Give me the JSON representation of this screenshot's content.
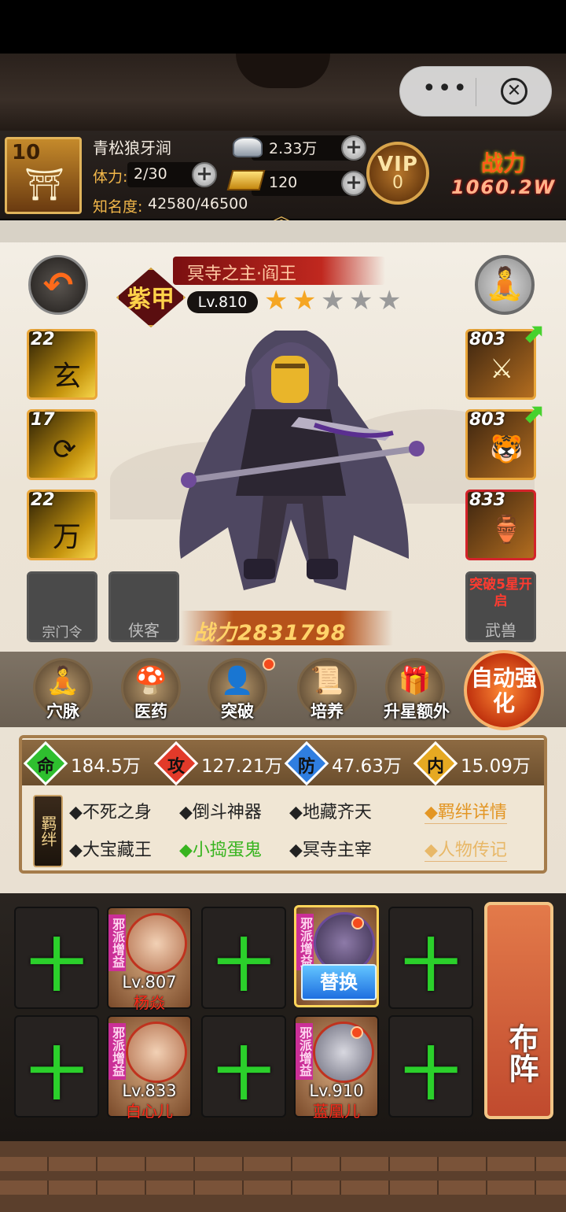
{
  "header": {
    "player_level": "10",
    "player_name": "青松狼牙涧",
    "stamina_label": "体力:",
    "stamina_value": "2/30",
    "fame_label": "知名度:",
    "fame_value": "42580/46500",
    "silver": "2.33万",
    "gold": "120",
    "vip_label": "VIP",
    "vip_level": "0",
    "power_label": "战力",
    "power_value": "1060.2W"
  },
  "character": {
    "rarity": "紫甲",
    "title": "冥寺之主·阎王",
    "level": "Lv.810",
    "stars_filled": 2,
    "stars_total": 5,
    "power": "战力2831798"
  },
  "skills": [
    {
      "level": "22",
      "glyph": "玄"
    },
    {
      "level": "17",
      "glyph": "⟳"
    },
    {
      "level": "22",
      "glyph": "万"
    }
  ],
  "equipment": [
    {
      "level": "803",
      "glyph": "⚔"
    },
    {
      "level": "803",
      "glyph": "🐯"
    },
    {
      "level": "833",
      "glyph": "🏺"
    }
  ],
  "locked_slots": {
    "sect_token": "宗门令",
    "retainer": "侠客",
    "beast_lock": "突破5星开启",
    "beast": "武兽"
  },
  "functions": [
    {
      "label": "穴脉",
      "icon": "meridian-icon",
      "glyph": "🧘"
    },
    {
      "label": "医药",
      "icon": "medicine-icon",
      "glyph": "🍄"
    },
    {
      "label": "突破",
      "icon": "breakthrough-icon",
      "glyph": "👤"
    },
    {
      "label": "培养",
      "icon": "cultivate-icon",
      "glyph": "📜"
    },
    {
      "label": "升星额外",
      "icon": "star-up-icon",
      "glyph": "🎁"
    }
  ],
  "auto_strengthen": "自动强化",
  "stats": [
    {
      "tag": "命",
      "value": "184.5万",
      "color": "#2fbf2f"
    },
    {
      "tag": "攻",
      "value": "127.21万",
      "color": "#e23a2a"
    },
    {
      "tag": "防",
      "value": "47.63万",
      "color": "#2f7ee0"
    },
    {
      "tag": "内",
      "value": "15.09万",
      "color": "#e6a922"
    }
  ],
  "bond_tag": "羁绊",
  "bonds": [
    {
      "text": "◆不死之身"
    },
    {
      "text": "◆倒斗神器"
    },
    {
      "text": "◆地藏齐天"
    },
    {
      "text": "◆大宝藏王"
    },
    {
      "text": "◆小捣蛋鬼"
    },
    {
      "text": "◆冥寺主宰"
    }
  ],
  "bond_details": "◆羁绊详情",
  "biography": "◆人物传记",
  "lineup": {
    "sect_tag": "邪派增益",
    "heroes": [
      {
        "level": "Lv.807",
        "name": "杨焱"
      },
      {
        "level": "",
        "name": ""
      },
      {
        "level": "Lv.833",
        "name": "白心儿"
      },
      {
        "level": "Lv.910",
        "name": "蓝凰儿"
      }
    ],
    "replace": "替换",
    "empty_slot": "十",
    "formation": "布阵"
  },
  "capsule": {
    "more": "•••",
    "close": "✕"
  }
}
